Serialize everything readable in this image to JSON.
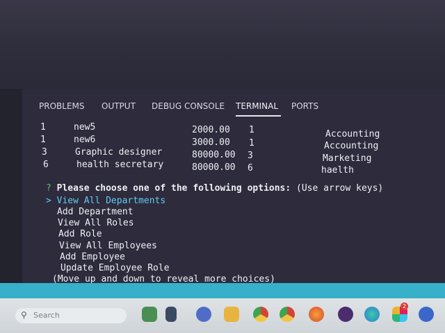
{
  "panel": {
    "tabs": [
      {
        "label": "PROBLEMS"
      },
      {
        "label": "OUTPUT"
      },
      {
        "label": "DEBUG CONSOLE"
      },
      {
        "label": "TERMINAL",
        "active": true
      },
      {
        "label": "PORTS"
      }
    ]
  },
  "terminal": {
    "rows": [
      {
        "id": "1",
        "title": "new5",
        "salary": "2000.00",
        "dept_id": "1",
        "department": "Accounting"
      },
      {
        "id": "1",
        "title": "new6",
        "salary": "3000.00",
        "dept_id": "1",
        "department": "Accounting"
      },
      {
        "id": "3",
        "title": "Graphic designer",
        "salary": "80000.00",
        "dept_id": "3",
        "department": "Marketing"
      },
      {
        "id": "6",
        "title": "health secretary",
        "salary": "80000.00",
        "dept_id": "6",
        "department": "haelth"
      }
    ],
    "prompt": {
      "marker": "?",
      "question": "Please choose one of the following options:",
      "hint": "(Use arrow keys)"
    },
    "pointer": ">",
    "choices": [
      {
        "label": "View All Departments",
        "selected": true
      },
      {
        "label": "Add Department"
      },
      {
        "label": "View All Roles"
      },
      {
        "label": "Add Role"
      },
      {
        "label": "View All Employees"
      },
      {
        "label": "Add Employee"
      },
      {
        "label": "Update Employee Role"
      }
    ],
    "footer": "(Move up and down to reveal more choices)"
  },
  "taskbar": {
    "search_placeholder": "Search",
    "icons": [
      "widgets-icon",
      "app-l-icon",
      "chat-icon",
      "file-explorer-icon",
      "chrome-icon",
      "chrome-alt-icon",
      "firefox-icon",
      "github-desktop-icon",
      "edge-icon",
      "slack-icon",
      "app-blue-icon"
    ],
    "notification_count": "2"
  },
  "colors": {
    "panel_bg": "#2d2b3c",
    "prompt_green": "#58c46a",
    "selected_cyan": "#63c9f2",
    "status_strip": "#37b0c9"
  }
}
